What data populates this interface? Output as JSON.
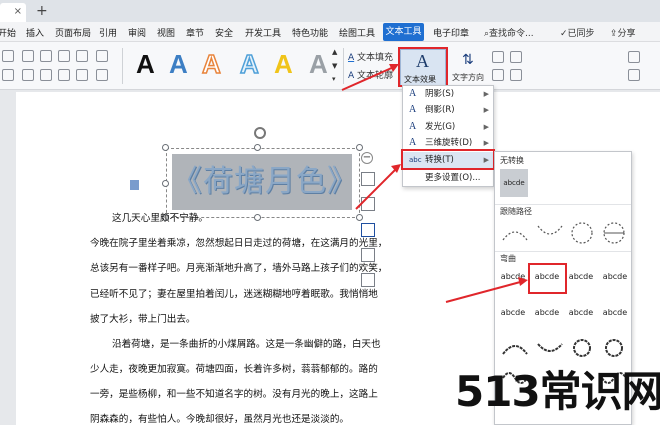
{
  "menu": {
    "items": [
      "开始",
      "插入",
      "页面布局",
      "引用",
      "审阅",
      "视图",
      "章节",
      "安全",
      "开发工具",
      "特色功能",
      "绘图工具"
    ],
    "active": "文本工具",
    "after_active": "电子印章",
    "search": "查找命令...",
    "sync": "已同步",
    "share": "分享"
  },
  "ribbon": {
    "style_letter": "A",
    "text_fill": "文本填充",
    "text_outline": "文本轮廓",
    "text_effect": "文本效果",
    "text_direction": "文字方向",
    "style_colors": [
      "#111111",
      "#3d7fc4",
      "#e8843c",
      "#4fa0d8",
      "#f0c419",
      "#9aa0a6"
    ]
  },
  "wordart": {
    "text": "《荷塘月色》"
  },
  "dropdown": {
    "items": [
      {
        "icon": "A",
        "label": "阴影(S)",
        "has_sub": true
      },
      {
        "icon": "A",
        "label": "倒影(R)",
        "has_sub": true
      },
      {
        "icon": "A",
        "label": "发光(G)",
        "has_sub": true
      },
      {
        "icon": "A",
        "label": "三维旋转(D)",
        "has_sub": true
      },
      {
        "icon": "abc",
        "label": "转换(T)",
        "has_sub": true
      },
      {
        "icon": "",
        "label": "更多设置(O)...",
        "has_sub": false
      }
    ]
  },
  "submenu": {
    "no_transform_label": "无转换",
    "no_transform_sample": "abcde",
    "follow_path_label": "跟随路径",
    "warp_label": "弯曲",
    "warp_samples": [
      "abcde",
      "abcde",
      "abcde",
      "abcde",
      "abcde",
      "abcde",
      "abcde",
      "abcde"
    ]
  },
  "document": {
    "lines": [
      "这几天心里颇不宁静。",
      "今晚在院子里坐着乘凉，忽然想起日日走过的荷塘，在这满月的光里，",
      "总该另有一番样子吧。月亮渐渐地升高了，墙外马路上孩子们的欢笑，",
      "已经听不见了；妻在屋里拍着闰儿，迷迷糊糊地哼着眠歌。我悄悄地",
      "披了大衫，带上门出去。",
      "沿着荷塘，是一条曲折的小煤屑路。这是一条幽僻的路，白天也",
      "少人走，夜晚更加寂寞。荷塘四面，长着许多树，蓊蓊郁郁的。路的",
      "一旁，是些杨柳，和一些不知道名字的树。没有月光的晚上，这路上",
      "阴森森的，有些怕人。今晚却很好，虽然月光也还是淡淡的。"
    ]
  },
  "watermark": "513常识网"
}
